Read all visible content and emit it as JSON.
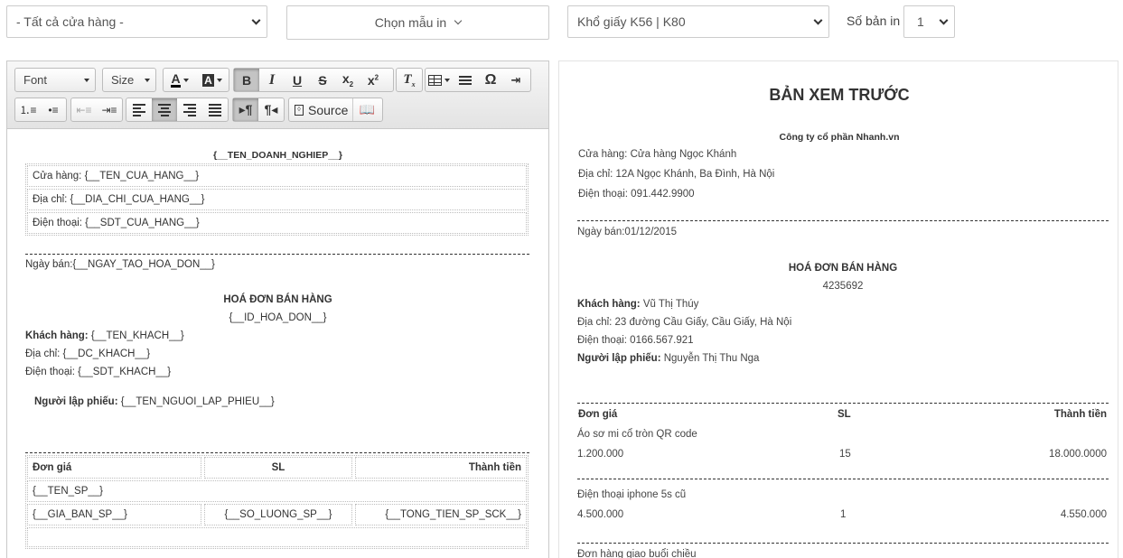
{
  "controls": {
    "store_select": "- Tất cả cửa hàng -",
    "template_select": "Chọn mẫu in",
    "paper_select": "Khổ giấy K56 | K80",
    "copies_label": "Số bản in",
    "copies_value": "1"
  },
  "toolbar": {
    "font_label": "Font",
    "size_label": "Size",
    "source_label": "Source"
  },
  "editor": {
    "company": "{__TEN_DOANH_NGHIEP__}",
    "store_line": "Cửa hàng: {__TEN_CUA_HANG__}",
    "address_line": "Địa chỉ: {__DIA_CHI_CUA_HANG__}",
    "phone_line": "Điện thoại: {__SDT_CUA_HANG__}",
    "date_line": "Ngày bán:{__NGAY_TAO_HOA_DON__}",
    "invoice_title": "HOÁ ĐƠN BÁN HÀNG",
    "invoice_id": "{__ID_HOA_DON__}",
    "customer_label": "Khách hàng:",
    "customer_value": " {__TEN_KHACH__}",
    "cust_address": "Địa chỉ: {__DC_KHACH__}",
    "cust_phone": "Điện thoại: {__SDT_KHACH__}",
    "creator_label": "Người lập phiếu:",
    "creator_value": " {__TEN_NGUOI_LAP_PHIEU__}",
    "col_price": "Đơn giá",
    "col_qty": "SL",
    "col_total": "Thành tiền",
    "product_name": "{__TEN_SP__}",
    "product_price": "{__GIA_BAN_SP__}",
    "product_qty": "{__SO_LUONG_SP__}",
    "product_total": "{__TONG_TIEN_SP_SCK__}"
  },
  "preview": {
    "title": "BẢN XEM TRƯỚC",
    "company": "Công ty cổ phần Nhanh.vn",
    "store_line": "Cửa hàng: Cửa hàng Ngọc Khánh",
    "address_line": "Địa chỉ: 12A Ngọc Khánh, Ba Đình, Hà Nội",
    "phone_line": "Điện thoại: 091.442.9900",
    "date_line": "Ngày bán:01/12/2015",
    "invoice_title": "HOÁ ĐƠN BÁN HÀNG",
    "invoice_id": "4235692",
    "customer_label": "Khách hàng:",
    "customer_value": " Vũ Thị Thúy",
    "cust_address": "Địa chỉ: 23 đường Cầu Giấy, Cầu Giấy, Hà Nội",
    "cust_phone": "Điện thoại: 0166.567.921",
    "creator_label": "Người lập phiếu:",
    "creator_value": " Nguyễn Thị Thu Nga",
    "col_price": "Đơn giá",
    "col_qty": "SL",
    "col_total": "Thành tiền",
    "items": [
      {
        "name": "Áo sơ mi cổ tròn QR code",
        "price": "1.200.000",
        "qty": "15",
        "total": "18.000.0000"
      },
      {
        "name": "Điện thoại iphone 5s cũ",
        "price": "4.500.000",
        "qty": "1",
        "total": "4.550.000"
      }
    ],
    "note": "Đơn hàng giao buổi chiều"
  }
}
